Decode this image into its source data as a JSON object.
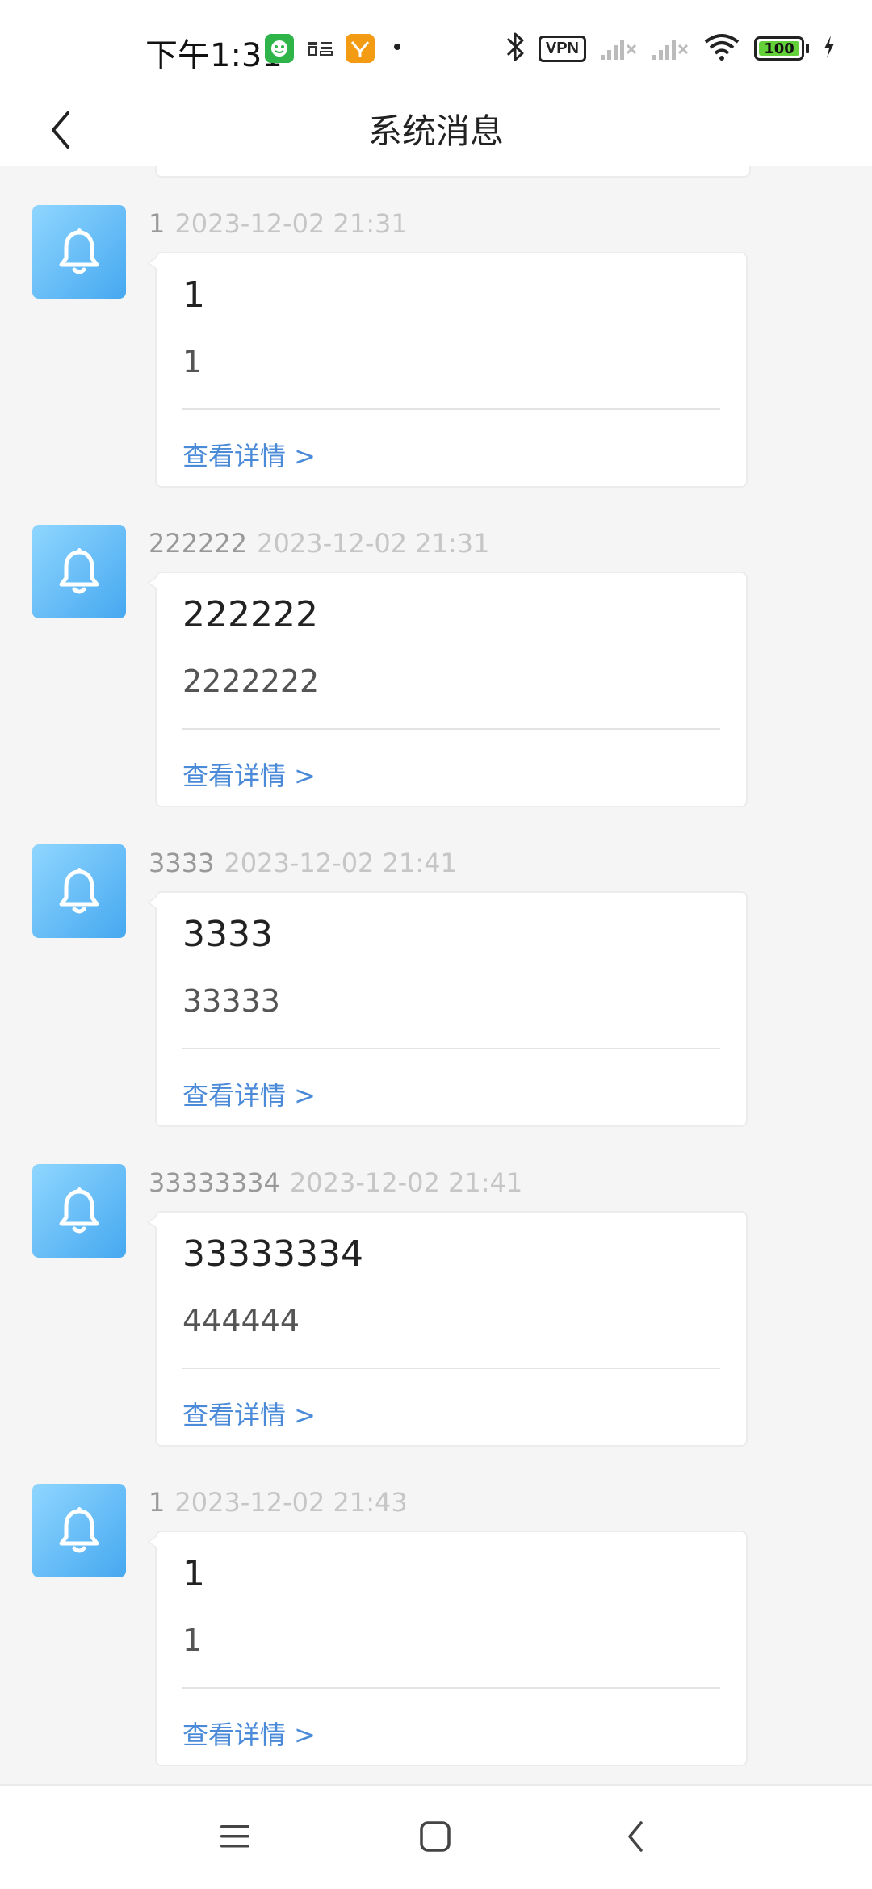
{
  "status_bar": {
    "time": "下午1:31",
    "vpn_label": "VPN",
    "battery_level": "100",
    "icons": [
      "wechat-icon",
      "word-icon",
      "tao-icon",
      "bluetooth-icon",
      "vpn-icon",
      "signal-icon",
      "signal-icon",
      "wifi-icon",
      "battery-icon",
      "charging-icon"
    ],
    "colors": {
      "battery_fill": "#64d13a",
      "wechat": "#2fb44a",
      "tao": "#f39b12"
    }
  },
  "header": {
    "title": "系统消息",
    "back_icon": "chevron-left-icon"
  },
  "messages": [
    {
      "sender": "1",
      "time": "2023-12-02 21:31",
      "title": "1",
      "content": "1",
      "link": "查看详情 >"
    },
    {
      "sender": "222222",
      "time": "2023-12-02 21:31",
      "title": "222222",
      "content": "2222222",
      "link": "查看详情 >"
    },
    {
      "sender": "3333",
      "time": "2023-12-02 21:41",
      "title": "3333",
      "content": "33333",
      "link": "查看详情 >"
    },
    {
      "sender": "33333334",
      "time": "2023-12-02 21:41",
      "title": "33333334",
      "content": "444444",
      "link": "查看详情 >"
    },
    {
      "sender": "1",
      "time": "2023-12-02 21:43",
      "title": "1",
      "content": "1",
      "link": "查看详情 >"
    }
  ],
  "message_icon": "bell-icon",
  "colors": {
    "avatar_gradient_start": "#8fd6ff",
    "avatar_gradient_end": "#46a8f0",
    "link": "#4a8ad8",
    "meta_sender": "#999999",
    "meta_time": "#c6c6c6"
  },
  "bottom_nav": {
    "icons": [
      "menu-icon",
      "home-icon",
      "back-icon"
    ]
  }
}
